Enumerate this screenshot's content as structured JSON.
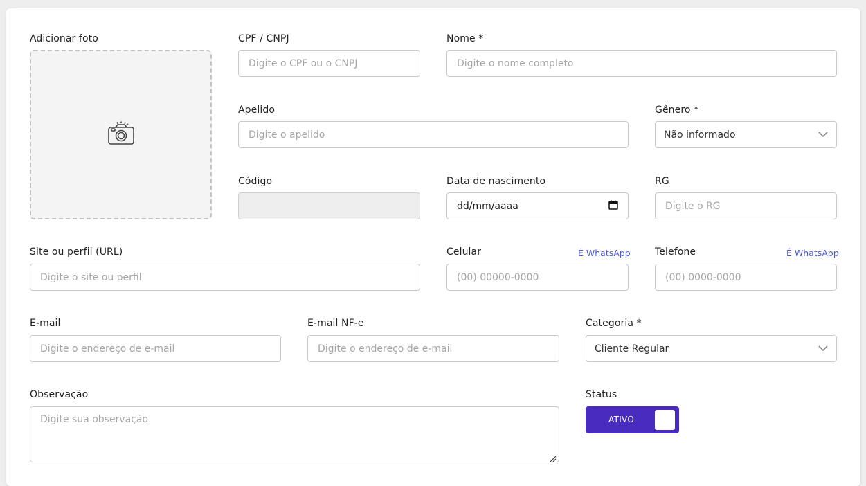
{
  "photo": {
    "label": "Adicionar foto",
    "icon": "camera-icon"
  },
  "cpf": {
    "label": "CPF / CNPJ",
    "placeholder": "Digite o CPF ou o CNPJ"
  },
  "nome": {
    "label": "Nome *",
    "placeholder": "Digite o nome completo"
  },
  "apelido": {
    "label": "Apelido",
    "placeholder": "Digite o apelido"
  },
  "genero": {
    "label": "Gênero *",
    "value": "Não informado"
  },
  "codigo": {
    "label": "Código",
    "value": ""
  },
  "nascimento": {
    "label": "Data de nascimento",
    "value": "dd/mm/aaaa"
  },
  "rg": {
    "label": "RG",
    "placeholder": "Digite o RG"
  },
  "site": {
    "label": "Site ou perfil (URL)",
    "placeholder": "Digite o site ou perfil"
  },
  "celular": {
    "label": "Celular",
    "whatsapp_link": "É WhatsApp",
    "placeholder": "(00) 00000-0000"
  },
  "telefone": {
    "label": "Telefone",
    "whatsapp_link": "É WhatsApp",
    "placeholder": "(00) 0000-0000"
  },
  "email": {
    "label": "E-mail",
    "placeholder": "Digite o endereço de e-mail"
  },
  "email_nfe": {
    "label": "E-mail NF-e",
    "placeholder": "Digite o endereço de e-mail"
  },
  "categoria": {
    "label": "Categoria *",
    "value": "Cliente Regular"
  },
  "observacao": {
    "label": "Observação",
    "placeholder": "Digite sua observação"
  },
  "status": {
    "label": "Status",
    "toggle_text": "ATIVO",
    "on": true
  },
  "colors": {
    "accent": "#4a2bbf",
    "link": "#4a5bd6",
    "border": "#c9c9c9"
  }
}
